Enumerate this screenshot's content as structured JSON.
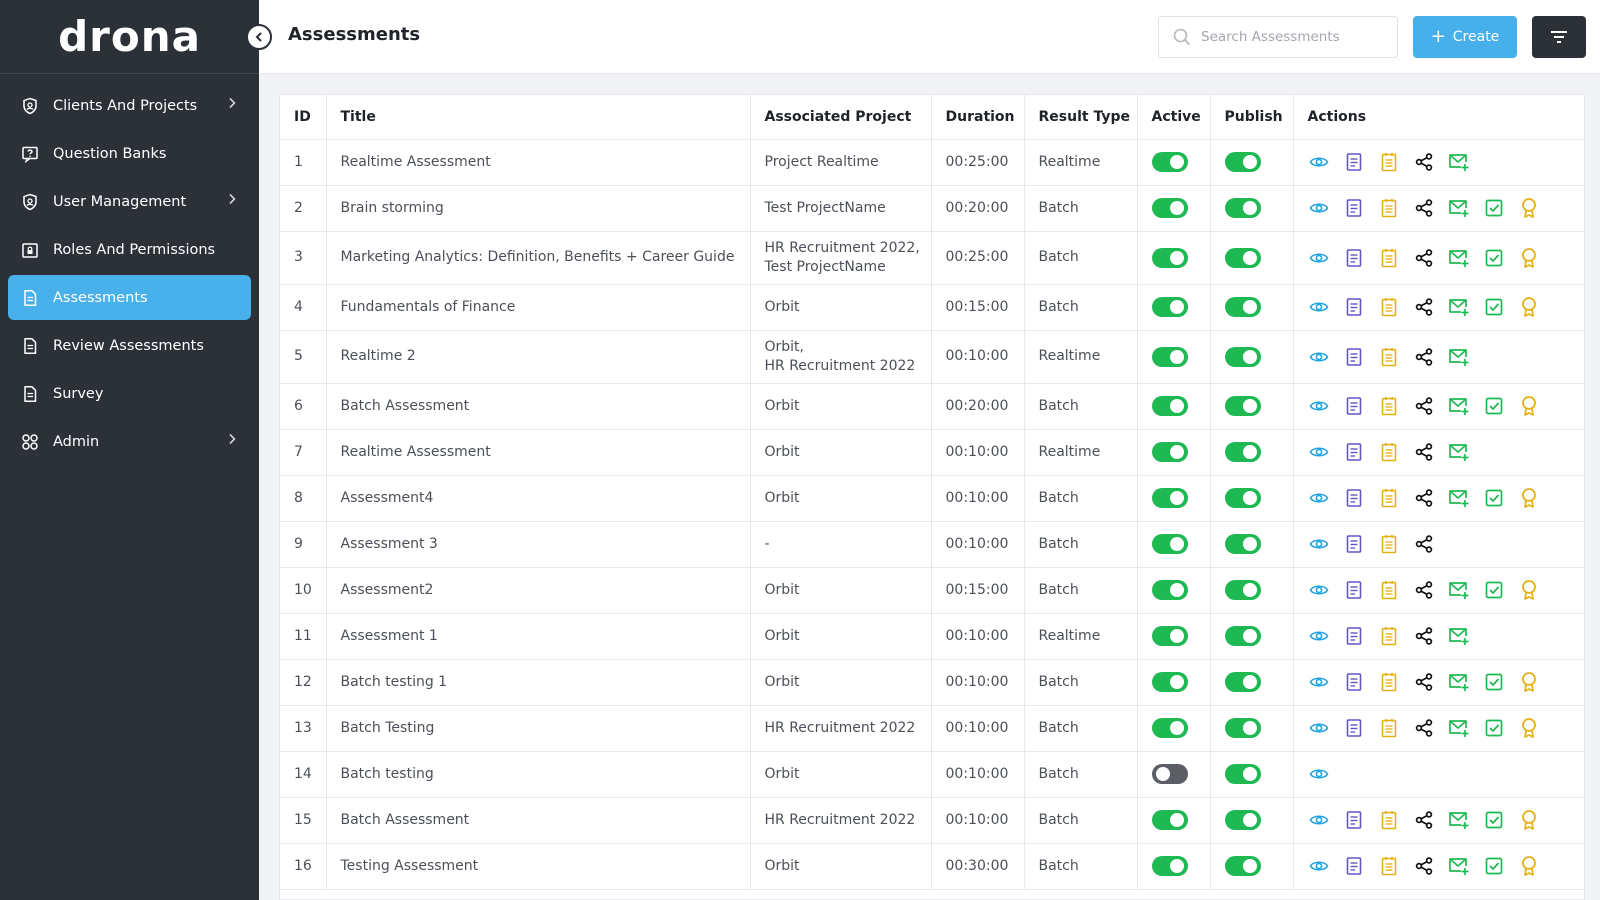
{
  "app": {
    "logo": "drona"
  },
  "sidebar": {
    "items": [
      {
        "label": "Clients And Projects",
        "icon": "shield-icon",
        "chevron": true,
        "active": false
      },
      {
        "label": "Question Banks",
        "icon": "question-box-icon",
        "chevron": false,
        "active": false
      },
      {
        "label": "User Management",
        "icon": "shield-icon",
        "chevron": true,
        "active": false
      },
      {
        "label": "Roles And Permissions",
        "icon": "lock-box-icon",
        "chevron": false,
        "active": false
      },
      {
        "label": "Assessments",
        "icon": "document-icon",
        "chevron": false,
        "active": true
      },
      {
        "label": "Review Assessments",
        "icon": "document-icon",
        "chevron": false,
        "active": false
      },
      {
        "label": "Survey",
        "icon": "document-icon",
        "chevron": false,
        "active": false
      },
      {
        "label": "Admin",
        "icon": "grid-icon",
        "chevron": true,
        "active": false
      }
    ]
  },
  "header": {
    "title": "Assessments",
    "search_placeholder": "Search Assessments",
    "create_label": "Create"
  },
  "colors": {
    "accent": "#47b0ea",
    "sidebar": "#2c3138",
    "toggle_on": "#1fb954",
    "toggle_off": "#5b5f65"
  },
  "table": {
    "columns": [
      "ID",
      "Title",
      "Associated Project",
      "Duration",
      "Result Type",
      "Active",
      "Publish",
      "Actions"
    ],
    "rows": [
      {
        "id": "1",
        "title": "Realtime Assessment",
        "project": [
          "Project Realtime"
        ],
        "duration": "00:25:00",
        "result": "Realtime",
        "active": true,
        "publish": true,
        "actions": [
          "view",
          "doc",
          "notes",
          "share",
          "mail"
        ]
      },
      {
        "id": "2",
        "title": "Brain storming",
        "project": [
          "Test ProjectName"
        ],
        "duration": "00:20:00",
        "result": "Batch",
        "active": true,
        "publish": true,
        "actions": [
          "view",
          "doc",
          "notes",
          "share",
          "mail",
          "check",
          "award"
        ]
      },
      {
        "id": "3",
        "title": "Marketing Analytics: Definition, Benefits + Career Guide",
        "project": [
          "HR Recruitment 2022,",
          "Test ProjectName"
        ],
        "duration": "00:25:00",
        "result": "Batch",
        "active": true,
        "publish": true,
        "actions": [
          "view",
          "doc",
          "notes",
          "share",
          "mail",
          "check",
          "award"
        ]
      },
      {
        "id": "4",
        "title": "Fundamentals of Finance",
        "project": [
          "Orbit"
        ],
        "duration": "00:15:00",
        "result": "Batch",
        "active": true,
        "publish": true,
        "actions": [
          "view",
          "doc",
          "notes",
          "share",
          "mail",
          "check",
          "award"
        ]
      },
      {
        "id": "5",
        "title": "Realtime 2",
        "project": [
          "Orbit,",
          "HR Recruitment 2022"
        ],
        "duration": "00:10:00",
        "result": "Realtime",
        "active": true,
        "publish": true,
        "actions": [
          "view",
          "doc",
          "notes",
          "share",
          "mail"
        ]
      },
      {
        "id": "6",
        "title": "Batch Assessment",
        "project": [
          "Orbit"
        ],
        "duration": "00:20:00",
        "result": "Batch",
        "active": true,
        "publish": true,
        "actions": [
          "view",
          "doc",
          "notes",
          "share",
          "mail",
          "check",
          "award"
        ]
      },
      {
        "id": "7",
        "title": "Realtime Assessment",
        "project": [
          "Orbit"
        ],
        "duration": "00:10:00",
        "result": "Realtime",
        "active": true,
        "publish": true,
        "actions": [
          "view",
          "doc",
          "notes",
          "share",
          "mail"
        ]
      },
      {
        "id": "8",
        "title": "Assessment4",
        "project": [
          "Orbit"
        ],
        "duration": "00:10:00",
        "result": "Batch",
        "active": true,
        "publish": true,
        "actions": [
          "view",
          "doc",
          "notes",
          "share",
          "mail",
          "check",
          "award"
        ]
      },
      {
        "id": "9",
        "title": "Assessment 3",
        "project": [
          "-"
        ],
        "duration": "00:10:00",
        "result": "Batch",
        "active": true,
        "publish": true,
        "actions": [
          "view",
          "doc",
          "notes",
          "share"
        ]
      },
      {
        "id": "10",
        "title": "Assessment2",
        "project": [
          "Orbit"
        ],
        "duration": "00:15:00",
        "result": "Batch",
        "active": true,
        "publish": true,
        "actions": [
          "view",
          "doc",
          "notes",
          "share",
          "mail",
          "check",
          "award"
        ]
      },
      {
        "id": "11",
        "title": "Assessment 1",
        "project": [
          "Orbit"
        ],
        "duration": "00:10:00",
        "result": "Realtime",
        "active": true,
        "publish": true,
        "actions": [
          "view",
          "doc",
          "notes",
          "share",
          "mail"
        ]
      },
      {
        "id": "12",
        "title": "Batch testing 1",
        "project": [
          "Orbit"
        ],
        "duration": "00:10:00",
        "result": "Batch",
        "active": true,
        "publish": true,
        "actions": [
          "view",
          "doc",
          "notes",
          "share",
          "mail",
          "check",
          "award"
        ]
      },
      {
        "id": "13",
        "title": "Batch Testing",
        "project": [
          "HR Recruitment 2022"
        ],
        "duration": "00:10:00",
        "result": "Batch",
        "active": true,
        "publish": true,
        "actions": [
          "view",
          "doc",
          "notes",
          "share",
          "mail",
          "check",
          "award"
        ]
      },
      {
        "id": "14",
        "title": "Batch testing",
        "project": [
          "Orbit"
        ],
        "duration": "00:10:00",
        "result": "Batch",
        "active": false,
        "publish": true,
        "actions": [
          "view"
        ]
      },
      {
        "id": "15",
        "title": "Batch Assessment",
        "project": [
          "HR Recruitment 2022"
        ],
        "duration": "00:10:00",
        "result": "Batch",
        "active": true,
        "publish": true,
        "actions": [
          "view",
          "doc",
          "notes",
          "share",
          "mail",
          "check",
          "award"
        ]
      },
      {
        "id": "16",
        "title": "Testing Assessment",
        "project": [
          "Orbit"
        ],
        "duration": "00:30:00",
        "result": "Batch",
        "active": true,
        "publish": true,
        "actions": [
          "view",
          "doc",
          "notes",
          "share",
          "mail",
          "check",
          "award"
        ]
      }
    ]
  }
}
